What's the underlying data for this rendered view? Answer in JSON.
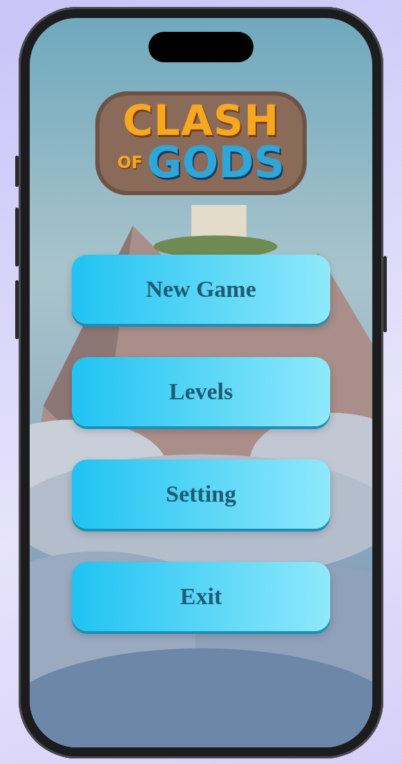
{
  "logo": {
    "line_1": "CLASH",
    "small_word": "OF",
    "line_2": "GODS"
  },
  "menu": [
    {
      "label": "New Game"
    },
    {
      "label": "Levels"
    },
    {
      "label": "Setting"
    },
    {
      "label": "Exit"
    }
  ]
}
